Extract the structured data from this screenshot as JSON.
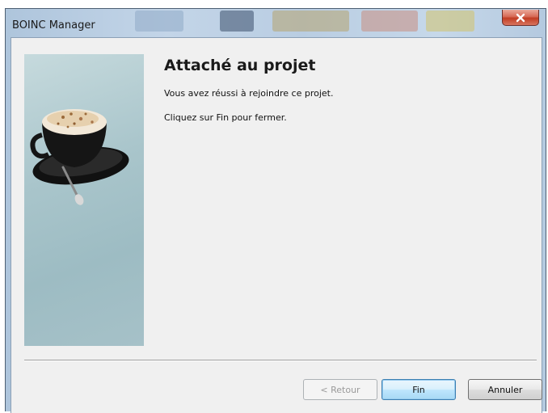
{
  "window": {
    "title": "BOINC Manager"
  },
  "wizard": {
    "heading": "Attaché au projet",
    "message": "Vous avez réussi à rejoindre ce projet.",
    "instruction": "Cliquez sur Fin pour fermer."
  },
  "buttons": {
    "back": "< Retour",
    "finish": "Fin",
    "cancel": "Annuler"
  },
  "colors": {
    "close_button": "#c94a33",
    "dialog_background": "#f0f0f0",
    "side_panel": "#a9c5cb"
  },
  "icons": {
    "close": "close-icon",
    "side_image": "coffee-cup-illustration"
  }
}
